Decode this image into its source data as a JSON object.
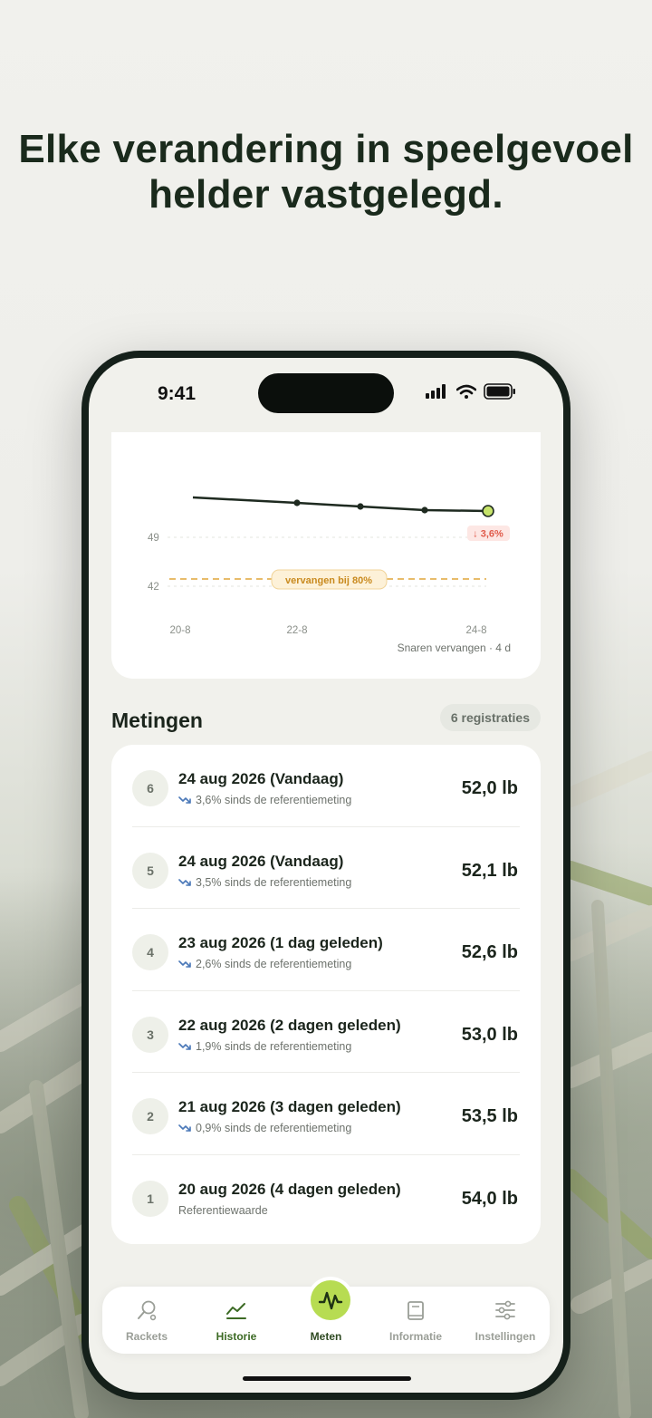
{
  "headline": {
    "line1": "Elke verandering in speelgevoel",
    "line2": "helder vastgelegd."
  },
  "status_bar": {
    "time": "9:41"
  },
  "chart": {
    "y_ticks": [
      "49",
      "42"
    ],
    "x_ticks": [
      "20-8",
      "22-8",
      "24-8"
    ],
    "change_badge": "↓ 3,6%",
    "threshold_label": "vervangen bij 80%",
    "footnote": "Snaren vervangen · 4 d"
  },
  "measurements": {
    "title": "Metingen",
    "count_label": "6 registraties",
    "rows": [
      {
        "index": "6",
        "date": "24 aug 2026 (Vandaag)",
        "subtitle": "3,6% sinds de referentiemeting",
        "trend": true,
        "value": "52,0 lb"
      },
      {
        "index": "5",
        "date": "24 aug 2026 (Vandaag)",
        "subtitle": "3,5% sinds de referentiemeting",
        "trend": true,
        "value": "52,1 lb"
      },
      {
        "index": "4",
        "date": "23 aug 2026 (1 dag geleden)",
        "subtitle": "2,6% sinds de referentiemeting",
        "trend": true,
        "value": "52,6 lb"
      },
      {
        "index": "3",
        "date": "22 aug 2026 (2 dagen geleden)",
        "subtitle": "1,9% sinds de referentiemeting",
        "trend": true,
        "value": "53,0 lb"
      },
      {
        "index": "2",
        "date": "21 aug 2026 (3 dagen geleden)",
        "subtitle": "0,9% sinds de referentiemeting",
        "trend": true,
        "value": "53,5 lb"
      },
      {
        "index": "1",
        "date": "20 aug 2026 (4 dagen geleden)",
        "subtitle": "Referentiewaarde",
        "trend": false,
        "value": "54,0 lb"
      }
    ]
  },
  "tabbar": {
    "tabs": [
      {
        "label": "Rackets",
        "icon": "racket-icon",
        "active": false
      },
      {
        "label": "Historie",
        "icon": "chart-line-icon",
        "active": true
      },
      {
        "label": "Meten",
        "icon": "waveform-icon",
        "active": false
      },
      {
        "label": "Informatie",
        "icon": "book-icon",
        "active": false
      },
      {
        "label": "Instellingen",
        "icon": "sliders-icon",
        "active": false
      }
    ]
  },
  "colors": {
    "accent_green": "#b7dc52",
    "active_tab": "#3c6a24",
    "threshold": "#e0a53a",
    "decline_red": "#e05a4a",
    "trend_blue": "#4a78b8"
  }
}
